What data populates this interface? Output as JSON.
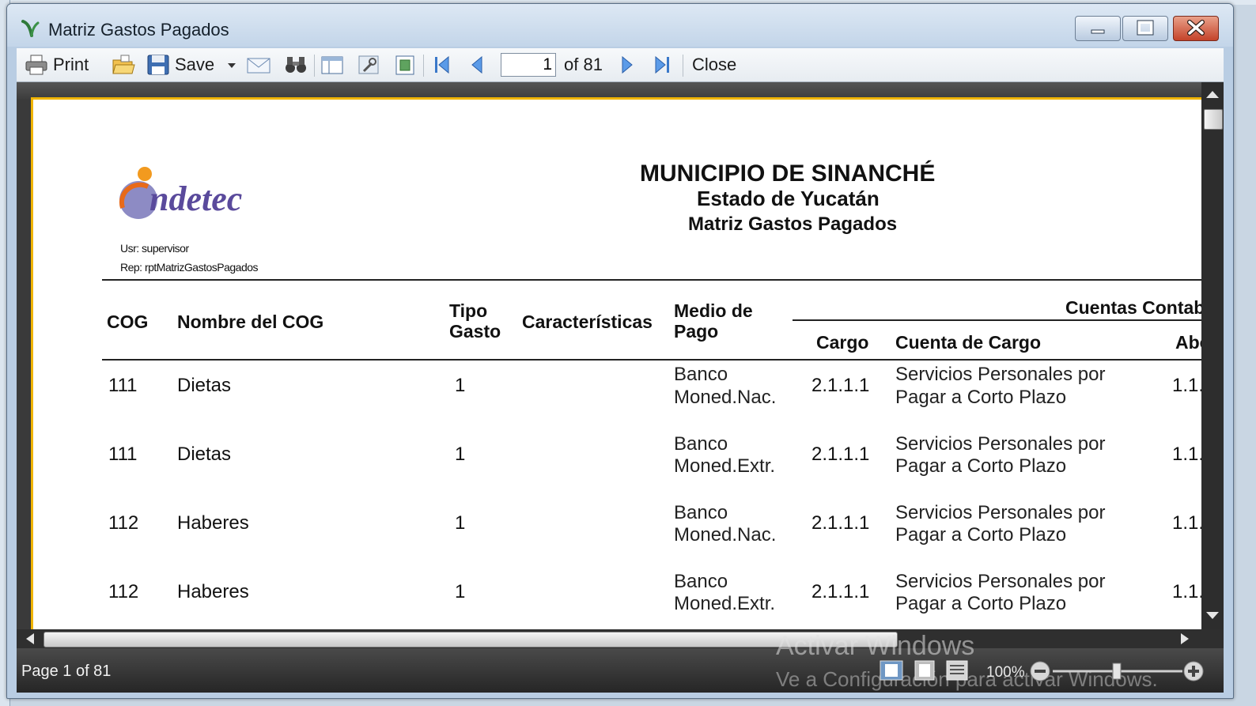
{
  "window": {
    "title": "Matriz Gastos Pagados"
  },
  "toolbar": {
    "print_label": "Print",
    "save_label": "Save",
    "page_value": "1",
    "of_pages": "of 81",
    "close_label": "Close"
  },
  "report": {
    "title": "MUNICIPIO DE SINANCHÉ",
    "subtitle": "Estado de Yucatán",
    "report_name": "Matriz Gastos Pagados",
    "logo_text": "indetec",
    "user_line": "Usr: supervisor",
    "rep_line": "Rep: rptMatrizGastosPagados",
    "columns": {
      "cog": "COG",
      "nombre": "Nombre del COG",
      "tipo_line1": "Tipo",
      "tipo_line2": "Gasto",
      "caracteristicas": "Características",
      "medio_line1": "Medio de",
      "medio_line2": "Pago",
      "cuentas_group": "Cuentas Contab",
      "cargo": "Cargo",
      "cuenta_cargo": "Cuenta de Cargo",
      "abono": "Abo"
    },
    "rows": [
      {
        "cog": "111",
        "nombre": "Dietas",
        "tipo": "1",
        "medio1": "Banco",
        "medio2": "Moned.Nac.",
        "cargo": "2.1.1.1",
        "cuenta1": "Servicios Personales por",
        "cuenta2": "Pagar a Corto Plazo",
        "abono": "1.1."
      },
      {
        "cog": "111",
        "nombre": "Dietas",
        "tipo": "1",
        "medio1": "Banco",
        "medio2": "Moned.Extr.",
        "cargo": "2.1.1.1",
        "cuenta1": "Servicios Personales por",
        "cuenta2": "Pagar a Corto Plazo",
        "abono": "1.1."
      },
      {
        "cog": "112",
        "nombre": "Haberes",
        "tipo": "1",
        "medio1": "Banco",
        "medio2": "Moned.Nac.",
        "cargo": "2.1.1.1",
        "cuenta1": "Servicios Personales por",
        "cuenta2": "Pagar a Corto Plazo",
        "abono": "1.1."
      },
      {
        "cog": "112",
        "nombre": "Haberes",
        "tipo": "1",
        "medio1": "Banco",
        "medio2": "Moned.Extr.",
        "cargo": "2.1.1.1",
        "cuenta1": "Servicios Personales por",
        "cuenta2": "Pagar a Corto Plazo",
        "abono": "1.1."
      }
    ]
  },
  "status": {
    "page_text": "Page 1 of 81",
    "zoom": "100%",
    "watermark_line1": "Activar Windows",
    "watermark_line2": "Ve a Configuración para activar Windows."
  }
}
